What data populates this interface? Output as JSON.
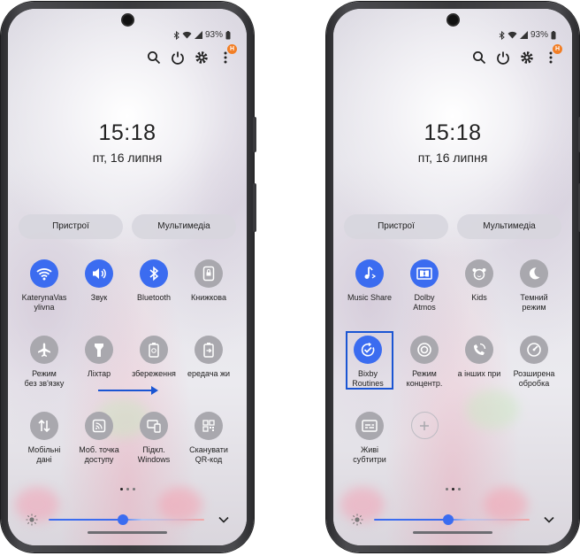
{
  "status": {
    "battery": "93%"
  },
  "header_icons": [
    "search-icon",
    "power-icon",
    "gear-icon",
    "more-icon"
  ],
  "notification_badge": "H",
  "lock": {
    "time": "15:18",
    "date": "пт, 16 липня"
  },
  "panel_buttons": {
    "devices": "Пристрої",
    "media": "Мультимедіа"
  },
  "left_tiles": [
    {
      "label": "KaterynaVas\nylivna",
      "icon": "wifi-icon",
      "state": "on"
    },
    {
      "label": "Звук",
      "icon": "sound-icon",
      "state": "on"
    },
    {
      "label": "Bluetooth",
      "icon": "bluetooth-icon",
      "state": "on"
    },
    {
      "label": "Книжкова",
      "icon": "portrait-lock-icon",
      "state": "off"
    },
    {
      "label": "Режим\nбез зв'язку",
      "icon": "airplane-icon",
      "state": "off"
    },
    {
      "label": "Ліхтар",
      "icon": "flashlight-icon",
      "state": "off"
    },
    {
      "label": "збереження",
      "icon": "power-saving-icon",
      "state": "off"
    },
    {
      "label": "ередача жи",
      "icon": "power-share-icon",
      "state": "off"
    },
    {
      "label": "Мобільні\nдані",
      "icon": "mobile-data-icon",
      "state": "off"
    },
    {
      "label": "Моб. точка\nдоступу",
      "icon": "hotspot-icon",
      "state": "off"
    },
    {
      "label": "Підкл.\nWindows",
      "icon": "link-windows-icon",
      "state": "off"
    },
    {
      "label": "Сканувати\nQR-код",
      "icon": "qr-code-icon",
      "state": "off"
    }
  ],
  "right_tiles": [
    {
      "label": "Music Share",
      "icon": "music-share-icon",
      "state": "on"
    },
    {
      "label": "Dolby\nAtmos",
      "icon": "dolby-icon",
      "state": "on"
    },
    {
      "label": "Kids",
      "icon": "kids-icon",
      "state": "off"
    },
    {
      "label": "Темний\nрежим",
      "icon": "dark-mode-icon",
      "state": "off"
    },
    {
      "label": "Bixby\nRoutines",
      "icon": "bixby-routines-icon",
      "state": "on"
    },
    {
      "label": "Режим\nконцентр.",
      "icon": "focus-mode-icon",
      "state": "off"
    },
    {
      "label": "а інших при",
      "icon": "call-other-devices-icon",
      "state": "off"
    },
    {
      "label": "Розширена\nобробка",
      "icon": "enhanced-processing-icon",
      "state": "off"
    },
    {
      "label": "Живі\nсубтитри",
      "icon": "live-caption-icon",
      "state": "off"
    },
    {
      "label": "",
      "icon": "add-icon",
      "state": "add"
    }
  ],
  "brightness": {
    "level": 0.48
  },
  "page_indicator": {
    "pages": 3,
    "current": 1
  },
  "colors": {
    "accent": "#3b6cf0",
    "highlight": "#1a55d3",
    "badge": "#f27e25"
  }
}
